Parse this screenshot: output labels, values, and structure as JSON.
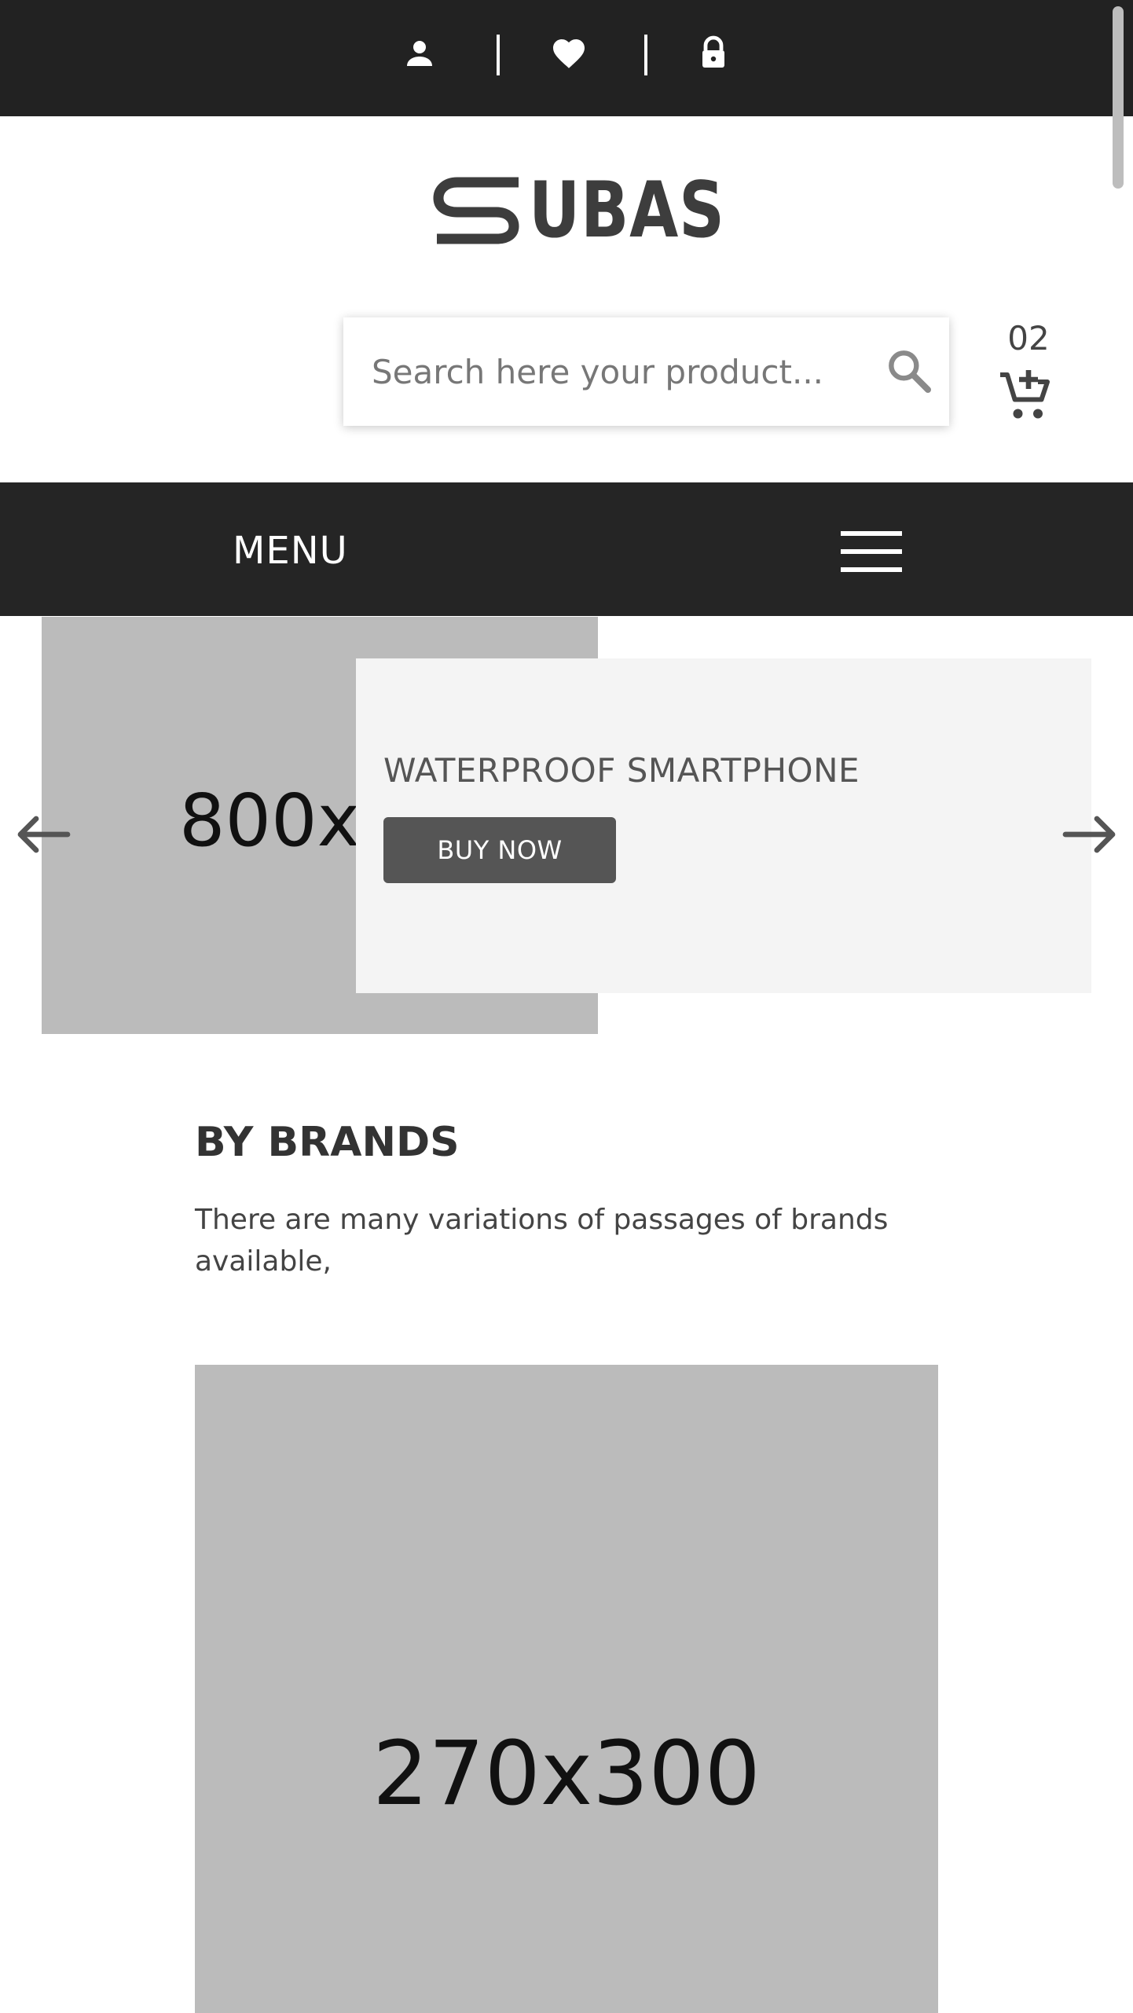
{
  "colors": {
    "dark_bar": "#222222",
    "menu_bar": "#252525",
    "placeholder_gray": "#bbbbbb",
    "button": "#555555",
    "panel": "#f4f4f4"
  },
  "topbar": {
    "icons": [
      "user-icon",
      "heart-icon",
      "lock-icon"
    ]
  },
  "logo": {
    "text": "UBAS"
  },
  "search": {
    "placeholder": "Search here your product..."
  },
  "cart": {
    "count": "02",
    "icon": "cart-add-icon"
  },
  "menu": {
    "label": "MENU",
    "icon": "hamburger-icon"
  },
  "slider": {
    "image_label": "800x600",
    "title": "WATERPROOF SMARTPHONE",
    "button_label": "BUY NOW",
    "prev_icon": "arrow-left-icon",
    "next_icon": "arrow-right-icon"
  },
  "brands": {
    "title": "BY BRANDS",
    "description": "There are many variations of passages of brands available,",
    "image_label": "270x300"
  }
}
